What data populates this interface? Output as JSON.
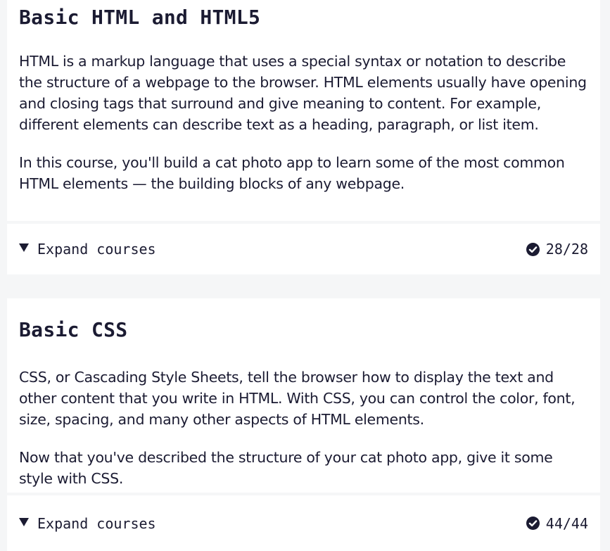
{
  "cards": [
    {
      "title": "Basic HTML and HTML5",
      "paragraphs": [
        "HTML is a markup language that uses a special syntax or notation to describe the structure of a webpage to the browser. HTML elements usually have opening and closing tags that surround and give meaning to content. For example, different elements can describe text as a heading, paragraph, or list item.",
        "In this course, you'll build a cat photo app to learn some of the most common HTML elements — the building blocks of any webpage."
      ],
      "expand_label": "Expand courses",
      "progress": "28/28",
      "completed": 28,
      "total": 28
    },
    {
      "title": "Basic CSS",
      "paragraphs": [
        "CSS, or Cascading Style Sheets, tell the browser how to display the text and other content that you write in HTML. With CSS, you can control the color, font, size, spacing, and many other aspects of HTML elements.",
        "Now that you've described the structure of your cat photo app, give it some style with CSS."
      ],
      "expand_label": "Expand courses",
      "progress": "44/44",
      "completed": 44,
      "total": 44
    }
  ],
  "colors": {
    "background": "#f5f6f7",
    "card": "#ffffff",
    "text": "#1b1b32"
  },
  "icons": {
    "caret": "caret-down-icon",
    "check": "check-circle-icon"
  }
}
